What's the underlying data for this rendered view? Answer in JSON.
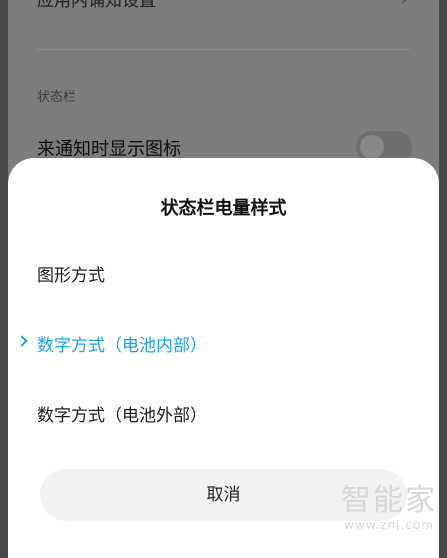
{
  "background": {
    "top_row_label": "应用内诵知设置",
    "section_header": "状态栏",
    "setting_label": "来通知时显示图标",
    "toggle_on": false
  },
  "sheet": {
    "title": "状态栏电量样式",
    "options": [
      {
        "label": "图形方式",
        "selected": false
      },
      {
        "label": "数字方式（电池内部）",
        "selected": true
      },
      {
        "label": "数字方式（电池外部）",
        "selected": false
      }
    ],
    "cancel_label": "取消"
  },
  "watermark": {
    "main": "智能家",
    "url": "www.znj.com"
  },
  "colors": {
    "accent": "#1a9ff0",
    "dim_overlay": "#7d7d7d",
    "sheet_bg": "#ffffff",
    "cancel_bg": "#f2f2f2"
  }
}
